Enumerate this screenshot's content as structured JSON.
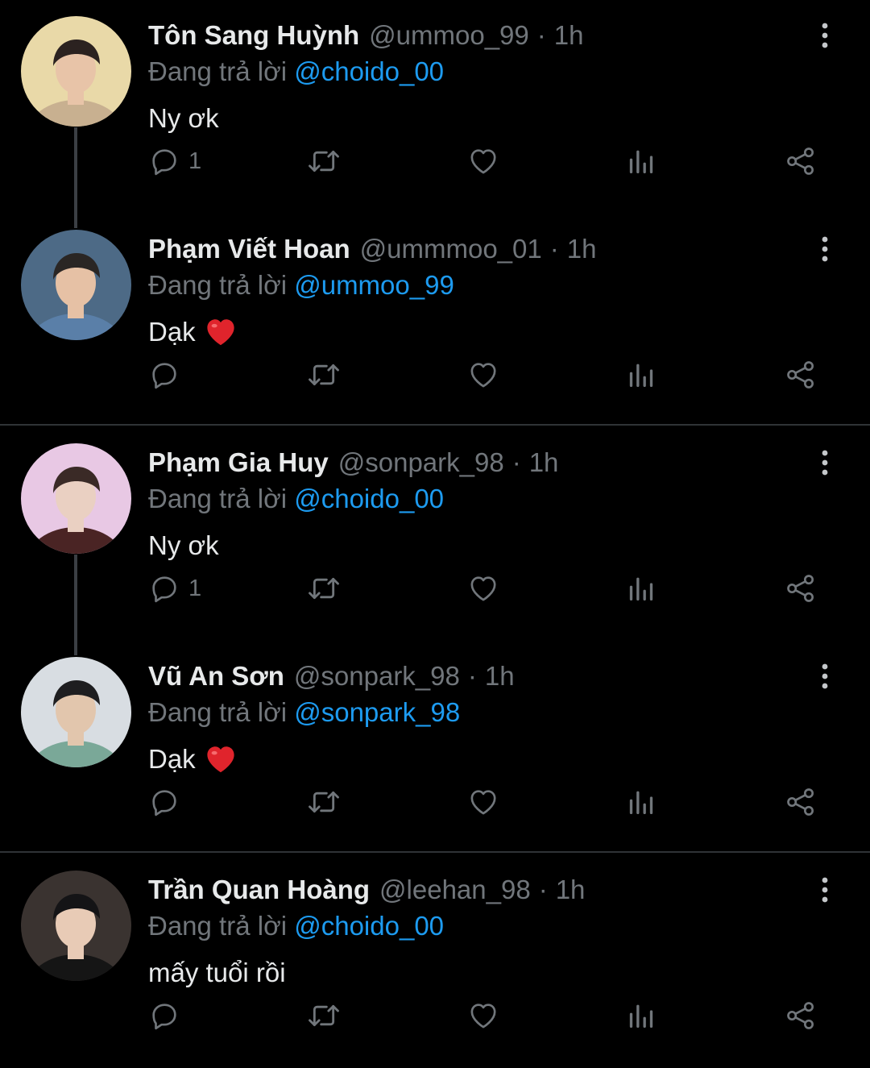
{
  "colors": {
    "background": "#000000",
    "text": "#e7e9ea",
    "muted": "#71767b",
    "link": "#1d9bf0",
    "divider": "#2f3336",
    "heart": "#e0242c"
  },
  "reply_prefix": "Đang trả lời",
  "tweets": [
    {
      "name": "Tôn Sang Huỳnh",
      "handle": "@ummoo_99",
      "time": "1h",
      "reply_to": "@choido_00",
      "text": "Ny ơk",
      "reply_count": "1",
      "emoji": "",
      "avatar_icon": "avatar-photo"
    },
    {
      "name": "Phạm Viết Hoan",
      "handle": "@ummmoo_01",
      "time": "1h",
      "reply_to": "@ummoo_99",
      "text": "Dạk",
      "reply_count": "",
      "emoji": "red-heart-emoji",
      "avatar_icon": "avatar-photo"
    },
    {
      "name": "Phạm Gia Huy",
      "handle": "@sonpark_98",
      "time": "1h",
      "reply_to": "@choido_00",
      "text": "Ny ơk",
      "reply_count": "1",
      "emoji": "",
      "avatar_icon": "avatar-photo"
    },
    {
      "name": "Vũ An Sơn",
      "handle": "@sonpark_98",
      "time": "1h",
      "reply_to": "@sonpark_98",
      "text": "Dạk",
      "reply_count": "",
      "emoji": "red-heart-emoji",
      "avatar_icon": "avatar-photo"
    },
    {
      "name": "Trần Quan Hoàng",
      "handle": "@leehan_98",
      "time": "1h",
      "reply_to": "@choido_00",
      "text": "mấy tuổi rồi",
      "reply_count": "",
      "emoji": "",
      "avatar_icon": "avatar-photo"
    }
  ],
  "action_icons": [
    "reply-icon",
    "retweet-icon",
    "like-icon",
    "views-icon",
    "share-icon"
  ]
}
